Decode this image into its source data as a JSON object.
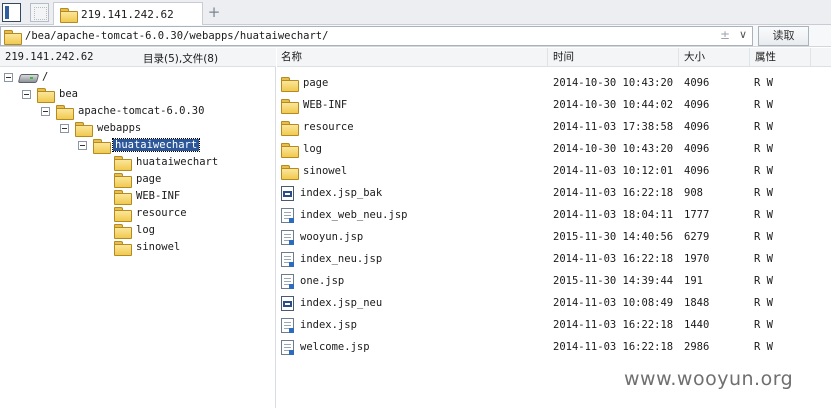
{
  "tab": {
    "title": "219.141.242.62",
    "add_label": "+"
  },
  "address": {
    "path": "/bea/apache-tomcat-6.0.30/webapps/huataiwechart/",
    "pm_label": "±",
    "dropdown_label": "∨",
    "read_label": "读取"
  },
  "left": {
    "host": "219.141.242.62",
    "summary": "目录(5),文件(8)",
    "tree": [
      {
        "label": "/",
        "icon": "drive-icon",
        "expander": true,
        "selected": false
      },
      {
        "label": "bea",
        "icon": "folder-icon",
        "expander": true,
        "selected": false
      },
      {
        "label": "apache-tomcat-6.0.30",
        "icon": "folder-icon",
        "expander": true,
        "selected": false
      },
      {
        "label": "webapps",
        "icon": "folder-icon",
        "expander": true,
        "selected": false
      },
      {
        "label": "huataiwechart",
        "icon": "folder-open-icon",
        "expander": true,
        "selected": true
      },
      {
        "label": "huataiwechart",
        "icon": "folder-icon",
        "expander": false,
        "selected": false
      },
      {
        "label": "page",
        "icon": "folder-icon",
        "expander": false,
        "selected": false
      },
      {
        "label": "WEB-INF",
        "icon": "folder-icon",
        "expander": false,
        "selected": false
      },
      {
        "label": "resource",
        "icon": "folder-icon",
        "expander": false,
        "selected": false
      },
      {
        "label": "log",
        "icon": "folder-icon",
        "expander": false,
        "selected": false
      },
      {
        "label": "sinowel",
        "icon": "folder-icon",
        "expander": false,
        "selected": false
      }
    ]
  },
  "right": {
    "columns": {
      "name": "名称",
      "time": "时间",
      "size": "大小",
      "attr": "属性"
    },
    "files": [
      {
        "name": "page",
        "time": "2014-10-30 10:43:20",
        "size": "4096",
        "attr": "R W",
        "icon": "folder-icon"
      },
      {
        "name": "WEB-INF",
        "time": "2014-10-30 10:44:02",
        "size": "4096",
        "attr": "R W",
        "icon": "folder-icon"
      },
      {
        "name": "resource",
        "time": "2014-11-03 17:38:58",
        "size": "4096",
        "attr": "R W",
        "icon": "folder-icon"
      },
      {
        "name": "log",
        "time": "2014-10-30 10:43:20",
        "size": "4096",
        "attr": "R W",
        "icon": "folder-icon"
      },
      {
        "name": "sinowel",
        "time": "2014-11-03 10:12:01",
        "size": "4096",
        "attr": "R W",
        "icon": "folder-icon"
      },
      {
        "name": "index.jsp_bak",
        "time": "2014-11-03 16:22:18",
        "size": "908",
        "attr": "R W",
        "icon": "config-file-icon"
      },
      {
        "name": "index_web_neu.jsp",
        "time": "2014-11-03 18:04:11",
        "size": "1777",
        "attr": "R W",
        "icon": "jsp-file-icon"
      },
      {
        "name": "wooyun.jsp",
        "time": "2015-11-30 14:40:56",
        "size": "6279",
        "attr": "R W",
        "icon": "jsp-file-icon"
      },
      {
        "name": "index_neu.jsp",
        "time": "2014-11-03 16:22:18",
        "size": "1970",
        "attr": "R W",
        "icon": "jsp-file-icon"
      },
      {
        "name": "one.jsp",
        "time": "2015-11-30 14:39:44",
        "size": "191",
        "attr": "R W",
        "icon": "jsp-file-icon"
      },
      {
        "name": "index.jsp_neu",
        "time": "2014-11-03 10:08:49",
        "size": "1848",
        "attr": "R W",
        "icon": "config-file-icon"
      },
      {
        "name": "index.jsp",
        "time": "2014-11-03 16:22:18",
        "size": "1440",
        "attr": "R W",
        "icon": "jsp-file-icon"
      },
      {
        "name": "welcome.jsp",
        "time": "2014-11-03 16:22:18",
        "size": "2986",
        "attr": "R W",
        "icon": "jsp-file-icon"
      }
    ]
  },
  "watermark": "www.wooyun.org"
}
